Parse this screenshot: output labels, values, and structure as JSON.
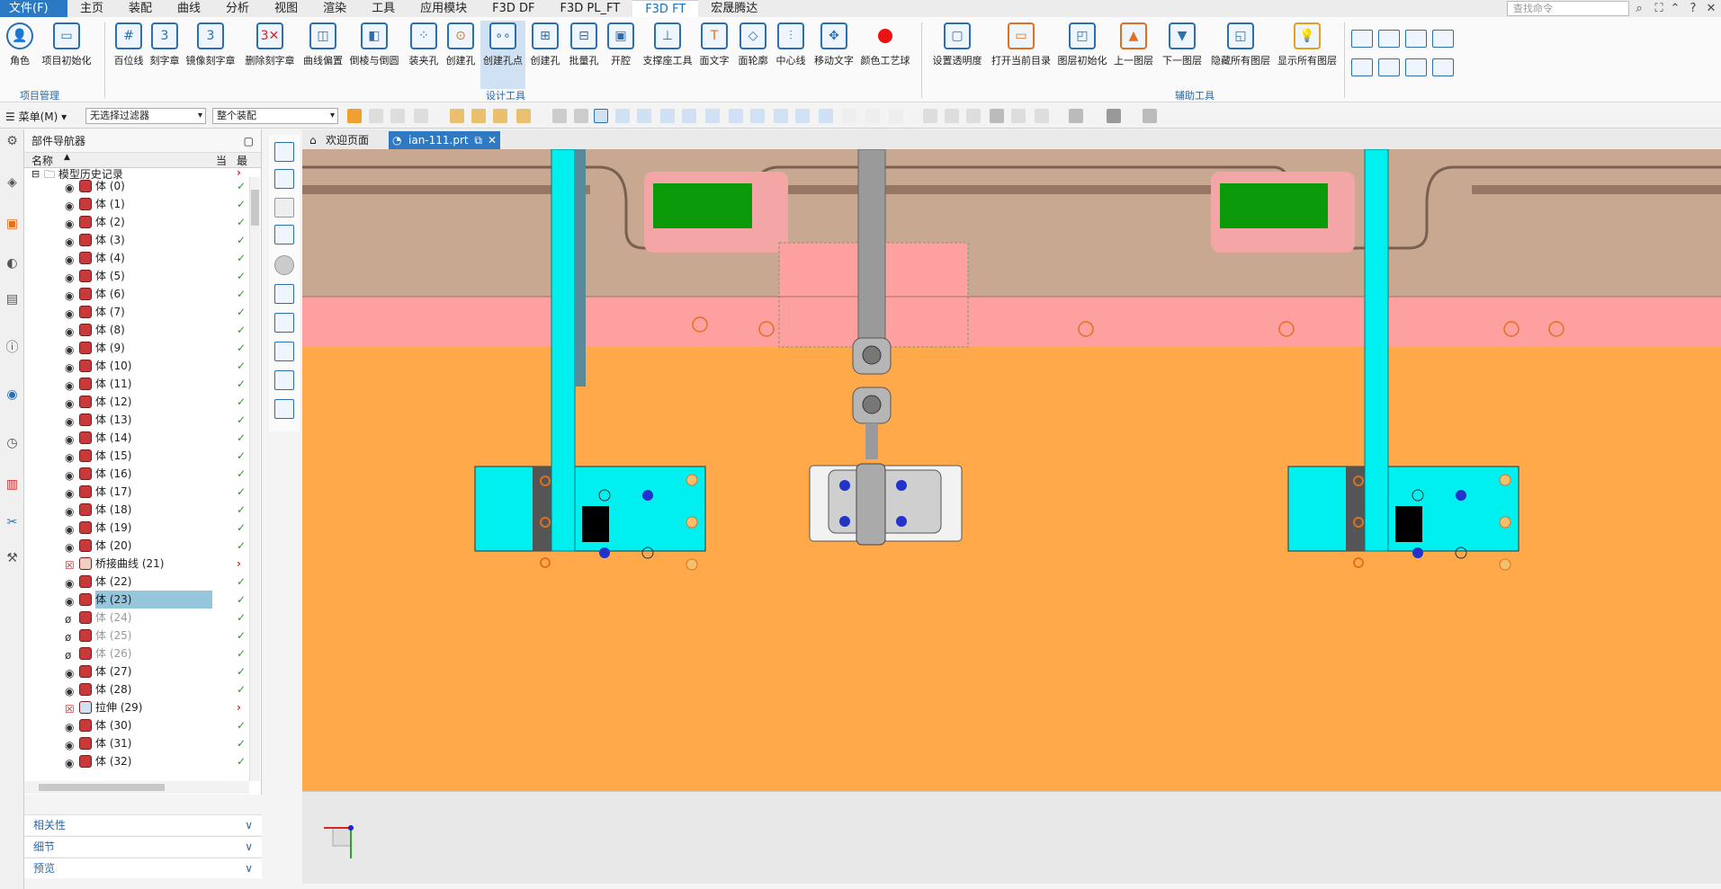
{
  "menu": {
    "items": [
      "文件(F)",
      "主页",
      "装配",
      "曲线",
      "分析",
      "视图",
      "渲染",
      "工具",
      "应用模块",
      "F3D DF",
      "F3D PL_FT",
      "F3D FT",
      "宏晟腾达"
    ],
    "search_placeholder": "查找命令"
  },
  "ribbon": {
    "groups": {
      "project": "项目管理",
      "design": "设计工具",
      "aux": "辅助工具"
    },
    "project_buttons": [
      "角色",
      "项目初始化"
    ],
    "design_buttons": [
      "百位线",
      "刻字章",
      "镜像刻字章",
      "删除刻字章",
      "曲线偏置",
      "倒棱与倒圆",
      "装夹孔",
      "创建孔",
      "创建孔点",
      "创建孔",
      "批量孔",
      "开腔",
      "支撑座工具",
      "面文字",
      "面轮廓",
      "中心线",
      "移动文字",
      "颜色工艺球"
    ],
    "aux_buttons": [
      "设置透明度",
      "打开当前目录",
      "图层初始化",
      "上一图层",
      "下一图层",
      "隐藏所有图层",
      "显示所有图层"
    ]
  },
  "toolbar": {
    "menu_label": "菜单(M)",
    "filter": "无选择过滤器",
    "assembly": "整个装配"
  },
  "navigator": {
    "title": "部件导航器",
    "col_name": "名称",
    "col_current": "当",
    "col_latest": "最",
    "root": "模型历史记录",
    "rows": [
      {
        "name": "体 (0)"
      },
      {
        "name": "体 (1)"
      },
      {
        "name": "体 (2)"
      },
      {
        "name": "体 (3)"
      },
      {
        "name": "体 (4)"
      },
      {
        "name": "体 (5)"
      },
      {
        "name": "体 (6)"
      },
      {
        "name": "体 (7)"
      },
      {
        "name": "体 (8)"
      },
      {
        "name": "体 (9)"
      },
      {
        "name": "体 (10)"
      },
      {
        "name": "体 (11)"
      },
      {
        "name": "体 (12)"
      },
      {
        "name": "体 (13)"
      },
      {
        "name": "体 (14)"
      },
      {
        "name": "体 (15)"
      },
      {
        "name": "体 (16)"
      },
      {
        "name": "体 (17)"
      },
      {
        "name": "体 (18)"
      },
      {
        "name": "体 (19)"
      },
      {
        "name": "体 (20)"
      },
      {
        "name": "桥接曲线 (21)"
      },
      {
        "name": "体 (22)"
      },
      {
        "name": "体 (23)"
      },
      {
        "name": "体 (24)"
      },
      {
        "name": "体 (25)"
      },
      {
        "name": "体 (26)"
      },
      {
        "name": "体 (27)"
      },
      {
        "name": "体 (28)"
      },
      {
        "name": "拉伸 (29)"
      },
      {
        "name": "体 (30)"
      },
      {
        "name": "体 (31)"
      },
      {
        "name": "体 (32)"
      }
    ],
    "panels": [
      "相关性",
      "细节",
      "预览"
    ]
  },
  "tabs": {
    "welcome": "欢迎页面",
    "file": "ian-111.prt"
  },
  "colors": {
    "accent": "#2f79c2",
    "viewport_bg": "#ffa94a",
    "cyan": "#00f0f0",
    "pink": "#ffa0a0",
    "green": "#00a000"
  }
}
